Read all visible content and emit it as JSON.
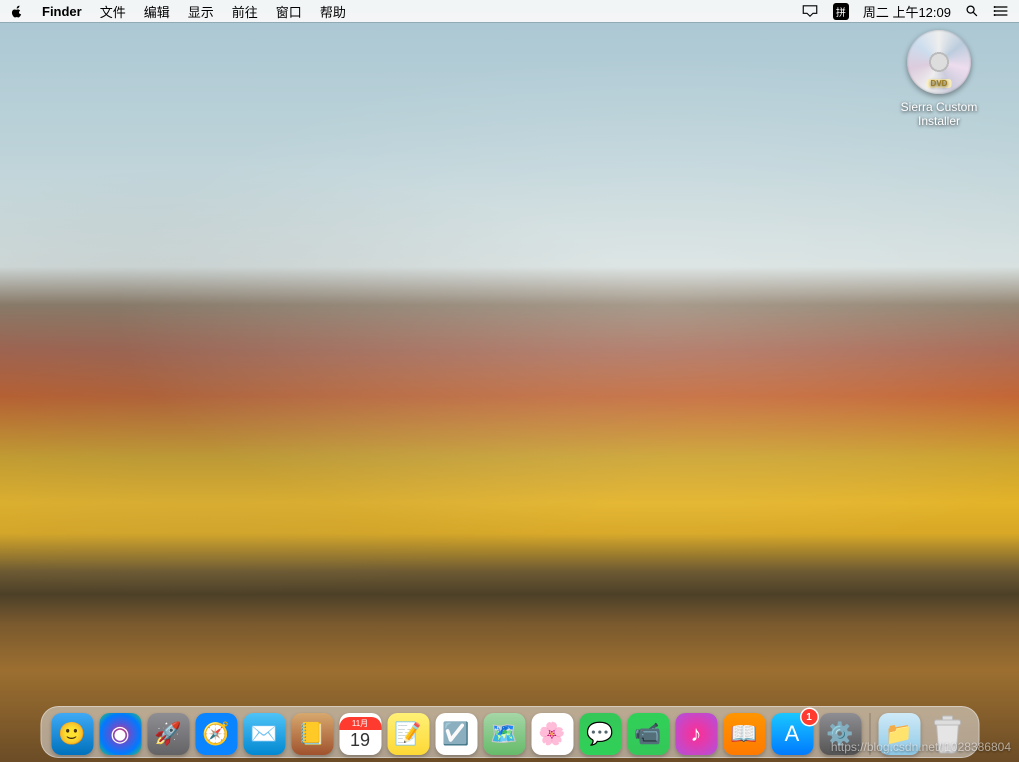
{
  "menubar": {
    "app": "Finder",
    "items": [
      "文件",
      "编辑",
      "显示",
      "前往",
      "窗口",
      "帮助"
    ],
    "ime": "拼",
    "datetime": "周二 上午12:09"
  },
  "desktop": {
    "dvd_label": "DVD",
    "icon_name": "Sierra Custom Installer"
  },
  "dock": {
    "calendar_month": "11月",
    "calendar_day": "19",
    "appstore_badge": "1",
    "apps": [
      {
        "name": "finder",
        "bg": "linear-gradient(#3fa9f5,#0071bc)",
        "glyph": "🙂"
      },
      {
        "name": "siri",
        "bg": "radial-gradient(circle at 50% 50%,#ff2d55,#5856d6,#007aff,#34c759)",
        "glyph": "◉"
      },
      {
        "name": "launchpad",
        "bg": "linear-gradient(#8e8e93,#636366)",
        "glyph": "🚀"
      },
      {
        "name": "safari",
        "bg": "radial-gradient(circle,#fff 35%,#0a84ff 36%)",
        "glyph": "🧭"
      },
      {
        "name": "mail",
        "bg": "linear-gradient(#4fc3f7,#0288d1)",
        "glyph": "✉️"
      },
      {
        "name": "contacts",
        "bg": "linear-gradient(#d7a86e,#a0522d)",
        "glyph": "📒"
      },
      {
        "name": "calendar",
        "bg": "#fff",
        "glyph": ""
      },
      {
        "name": "notes",
        "bg": "linear-gradient(#fff176,#fdd835)",
        "glyph": "📝"
      },
      {
        "name": "reminders",
        "bg": "#fff",
        "glyph": "☑️"
      },
      {
        "name": "maps",
        "bg": "linear-gradient(#a5d6a7,#66bb6a)",
        "glyph": "🗺️"
      },
      {
        "name": "photos",
        "bg": "#fff",
        "glyph": "🌸"
      },
      {
        "name": "messages",
        "bg": "linear-gradient(#34c759,#30d158)",
        "glyph": "💬"
      },
      {
        "name": "facetime",
        "bg": "linear-gradient(#30d158,#34c759)",
        "glyph": "📹"
      },
      {
        "name": "itunes",
        "bg": "radial-gradient(circle,#ff2d92,#af52de)",
        "glyph": "♪"
      },
      {
        "name": "ibooks",
        "bg": "linear-gradient(#ff9500,#ff7a00)",
        "glyph": "📖"
      },
      {
        "name": "appstore",
        "bg": "linear-gradient(#1ac7ff,#007aff)",
        "glyph": "A"
      },
      {
        "name": "system-preferences",
        "bg": "linear-gradient(#8e8e93,#555)",
        "glyph": "⚙️"
      }
    ]
  },
  "watermark": "https://blog.csdn.net/l1028386804"
}
